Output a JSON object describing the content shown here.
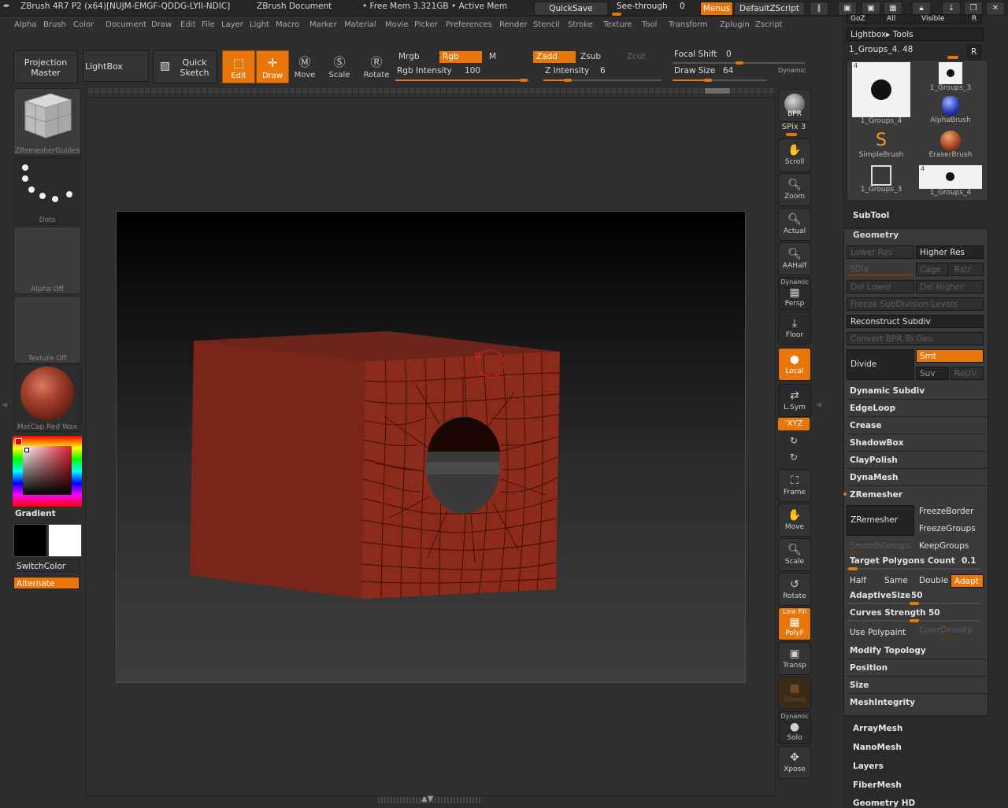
{
  "titlebar": {
    "app_title": "ZBrush 4R7 P2 (x64)[NUJM-EMGF-QDDG-LYII-NDIC]",
    "doc_title": "ZBrush Document",
    "mem": "• Free Mem 3.321GB • Active Mem",
    "quicksave": "QuickSave",
    "seethrough": "See-through",
    "seethrough_value": "0",
    "menus": "Menus",
    "defaultzscript": "DefaultZScript"
  },
  "menu": [
    "Alpha",
    "Brush",
    "Color",
    "Document",
    "Draw",
    "Edit",
    "File",
    "Layer",
    "Light",
    "Macro",
    "Marker",
    "Material",
    "Movie",
    "Picker",
    "Preferences",
    "Render",
    "Stencil",
    "Stroke",
    "Texture",
    "Tool",
    "Transform",
    "Zplugin",
    "Zscript"
  ],
  "toolbar": {
    "projection_master_1": "Projection",
    "projection_master_2": "Master",
    "lightbox": "LightBox",
    "quick_sketch_1": "Quick",
    "quick_sketch_2": "Sketch",
    "edit": "Edit",
    "draw": "Draw",
    "move": "Move",
    "scale": "Scale",
    "rotate": "Rotate",
    "mrgb": "Mrgb",
    "rgb": "Rgb",
    "m": "M",
    "zadd": "Zadd",
    "zsub": "Zsub",
    "zcut": "Zcut",
    "rgb_intensity_label": "Rgb Intensity",
    "rgb_intensity": "100",
    "z_intensity_label": "Z Intensity",
    "z_intensity": "6",
    "focal_shift_label": "Focal Shift",
    "focal_shift": "0",
    "draw_size_label": "Draw Size",
    "draw_size": "64",
    "dynamic": "Dynamic"
  },
  "left_panel": {
    "zremesher_guides": "ZRemesherGuides",
    "dots": "Dots",
    "alpha_off": "Alpha Off",
    "texture_off": "Texture Off",
    "matcap": "MatCap Red Wax",
    "gradient": "Gradient",
    "switchcolor": "SwitchColor",
    "alternate": "Alternate"
  },
  "shelf": {
    "bpr": "BPR",
    "spix_label": "SPix",
    "spix": "3",
    "scroll": "Scroll",
    "zoom": "Zoom",
    "actual": "Actual",
    "aahalf": "AAHalf",
    "dynamic": "Dynamic",
    "persp": "Persp",
    "floor": "Floor",
    "local": "Local",
    "lsym": "L.Sym",
    "xyz": "‘XYZ",
    "frame": "Frame",
    "move": "Move",
    "scale": "Scale",
    "rotate": "Rotate",
    "linefill": "Line Fill",
    "polyf": "PolyF",
    "transp": "Transp",
    "ghost": "Ghost",
    "dynamic2": "Dynamic",
    "solo": "Solo",
    "xpose": "Xpose"
  },
  "tool_panel": {
    "top_tabs": [
      "GoZ",
      "All",
      "Visible",
      "R"
    ],
    "lightbox_tools": "Lightbox▸ Tools",
    "current_tool": "1_Groups_4. 48",
    "r": "R",
    "thumbs": [
      {
        "label": "1_Groups_4",
        "badge": "4"
      },
      {
        "label": "1_Groups_3",
        "badge": ""
      },
      {
        "label": "AlphaBrush",
        "badge": ""
      },
      {
        "label": "SimpleBrush",
        "badge": ""
      },
      {
        "label": "EraserBrush",
        "badge": ""
      },
      {
        "label": "1_Groups_3",
        "badge": ""
      },
      {
        "label": "1_Groups_4",
        "badge": "4"
      }
    ],
    "subtool": "SubTool",
    "geometry": "Geometry",
    "lower_res": "Lower Res",
    "higher_res": "Higher Res",
    "sdiv": "SDiv",
    "cage": "Cage",
    "rstr": "Rstr",
    "del_lower": "Del Lower",
    "del_higher": "Del Higher",
    "freeze_subdiv": "Freeze SubDivision Levels",
    "reconstruct_subdiv": "Reconstruct Subdiv",
    "convert_bpr": "Convert BPR To Geo",
    "divide": "Divide",
    "smt": "Smt",
    "suv": "Suv",
    "reuv": "ReUV",
    "dynamic_subdiv": "Dynamic Subdiv",
    "edgeloop": "EdgeLoop",
    "crease": "Crease",
    "shadowbox": "ShadowBox",
    "claypolish": "ClayPolish",
    "dynamesh": "DynaMesh",
    "zremesher_section": "ZRemesher",
    "zremesher_btn": "ZRemesher",
    "freezeborder": "FreezeBorder",
    "freezegroups": "FreezeGroups",
    "smoothgroups": "SmoothGroups",
    "keepgroups": "KeepGroups",
    "target_poly_label": "Target Polygons Count",
    "target_poly": "0.1",
    "half": "Half",
    "same": "Same",
    "double": "Double",
    "adapt": "Adapt",
    "adaptivesize_label": "AdaptiveSize",
    "adaptivesize": "50",
    "curves_strength_label": "Curves Strength",
    "curves_strength": "50",
    "use_polypaint": "Use Polypaint",
    "colordensity": "ColorDensity",
    "modify_topology": "Modify Topology",
    "position": "Position",
    "size": "Size",
    "meshintegrity": "MeshIntegrity",
    "arraymesh": "ArrayMesh",
    "nanomesh": "NanoMesh",
    "layers": "Layers",
    "fibermesh": "FiberMesh",
    "geometry_hd": "Geometry HD"
  },
  "colors": {
    "accent": "#e8760b",
    "mesh": "#7a2419",
    "background": "#2e2e2e"
  }
}
